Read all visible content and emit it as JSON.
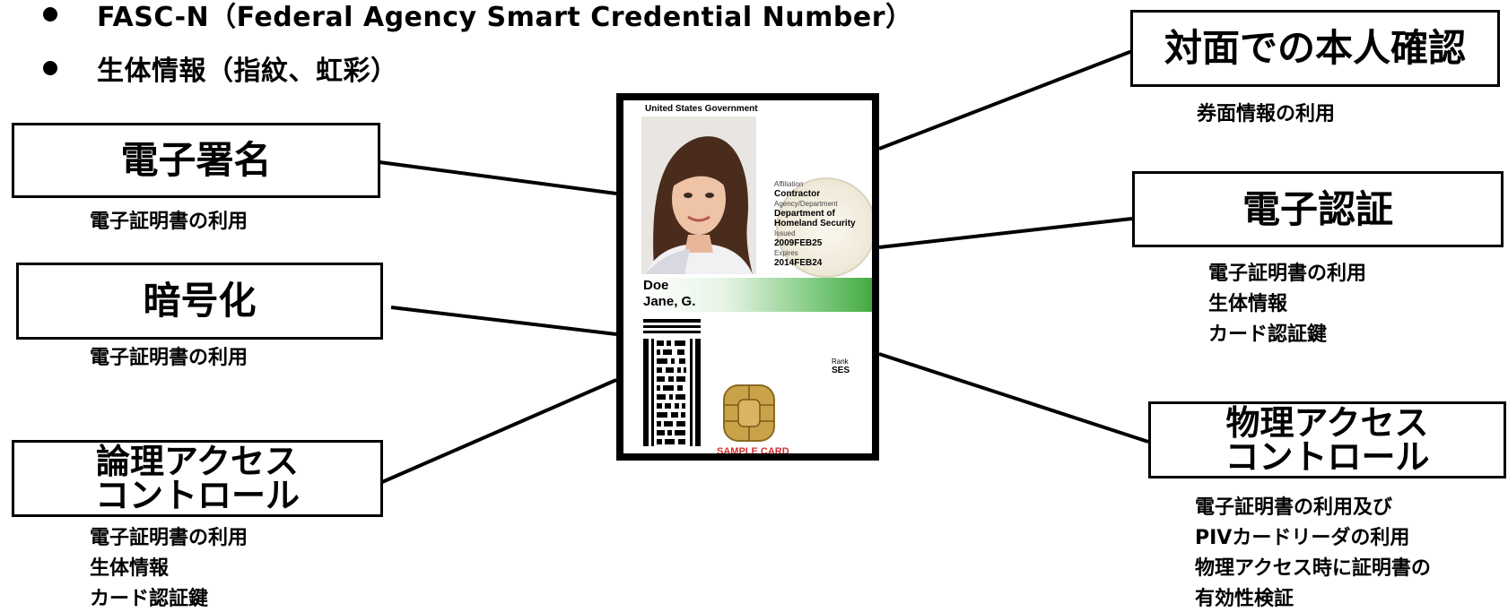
{
  "bullets": [
    "FASC-N（Federal Agency Smart Credential Number）",
    "生体情報（指紋、虹彩）"
  ],
  "left_boxes": {
    "signature": {
      "label": "電子署名",
      "notes": [
        "電子証明書の利用"
      ]
    },
    "encryption": {
      "label": "暗号化",
      "notes": [
        "電子証明書の利用"
      ]
    },
    "logical_access": {
      "label_lines": [
        "論理アクセス",
        "コントロール"
      ],
      "notes": [
        "電子証明書の利用",
        "生体情報",
        "カード認証鍵"
      ]
    }
  },
  "right_boxes": {
    "in_person": {
      "label": "対面での本人確認",
      "notes": [
        "券面情報の利用"
      ]
    },
    "authentication": {
      "label": "電子認証",
      "notes": [
        "電子証明書の利用",
        "生体情報",
        "カード認証鍵"
      ]
    },
    "physical_access": {
      "label_lines": [
        "物理アクセス",
        "コントロール"
      ],
      "notes": [
        "電子証明書の利用及び",
        "PIVカードリーダの利用",
        "物理アクセス時に証明書の",
        "有効性検証"
      ]
    }
  },
  "card": {
    "government": "United States Government",
    "affiliation_label": "Affiliation",
    "affiliation": "Contractor",
    "agency_label": "Agency/Department",
    "agency_lines": [
      "Department of",
      "Homeland Security"
    ],
    "issued_label": "Issued",
    "issued": "2009FEB25",
    "expires_label": "Expires",
    "expires": "2014FEB24",
    "last_name": "Doe",
    "first_name": "Jane, G.",
    "rank_label": "Rank",
    "rank": "SES",
    "sample": "SAMPLE CARD"
  },
  "colors": {
    "name_bar_green": "#3ba63b",
    "sample_text": "#d32f2f",
    "chip_gold": "#c9a24a"
  }
}
